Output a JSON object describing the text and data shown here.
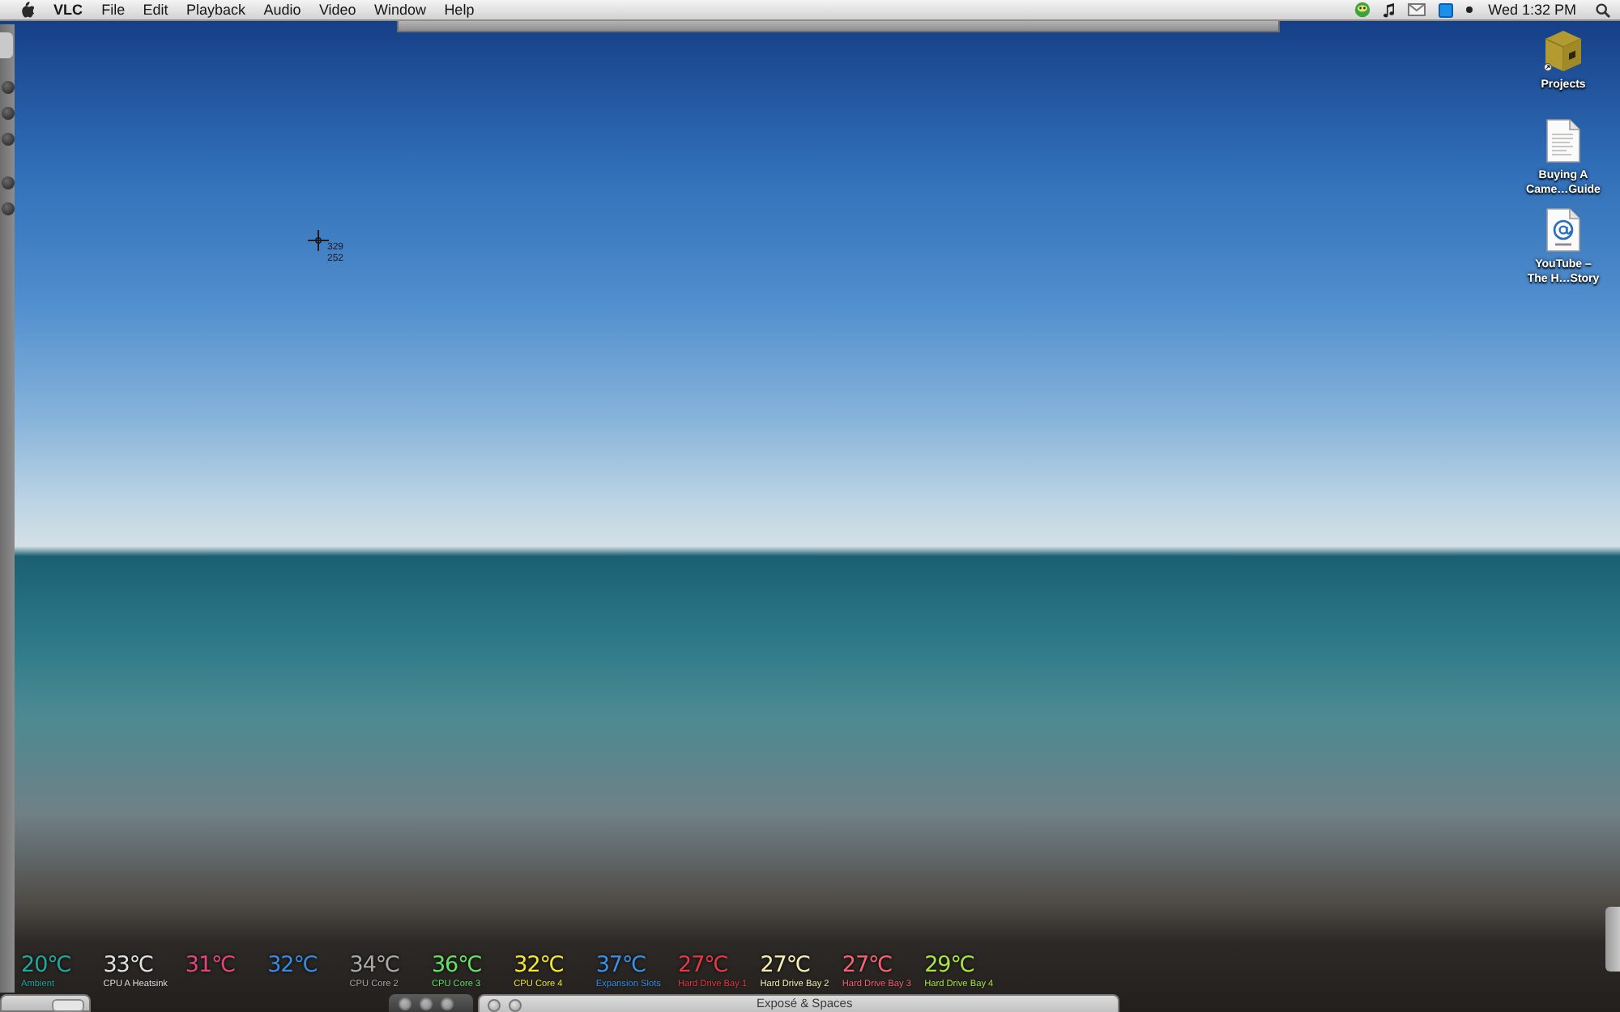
{
  "menu_bar": {
    "app_name": "VLC",
    "menus": [
      "File",
      "Edit",
      "Playback",
      "Audio",
      "Video",
      "Window",
      "Help"
    ],
    "clock": "Wed 1:32 PM"
  },
  "desktop_icons": [
    {
      "kind": "box",
      "label": "Projects"
    },
    {
      "kind": "document",
      "label": "Buying A Came…Guide"
    },
    {
      "kind": "weblink",
      "label": "YouTube – The H…Story"
    }
  ],
  "crosshair": {
    "readings": [
      "329",
      "252"
    ]
  },
  "sensors": [
    {
      "value": "20℃",
      "label": "Ambient",
      "color": "#22a89a"
    },
    {
      "value": "33℃",
      "label": "CPU A Heatsink",
      "color": "#e0e0e0"
    },
    {
      "value": "31℃",
      "color": "#e0467e"
    },
    {
      "value": "32℃",
      "color": "#3a8ae0"
    },
    {
      "value": "34℃",
      "label": "CPU Core 2",
      "color": "#a9a9a9"
    },
    {
      "value": "36℃",
      "label": "CPU Core 3",
      "color": "#66e066"
    },
    {
      "value": "32℃",
      "label": "CPU Core 4",
      "color": "#f2e634"
    },
    {
      "value": "37℃",
      "label": "Expansion Slots",
      "color": "#3b90e6"
    },
    {
      "value": "27℃",
      "label": "Hard Drive Bay 1",
      "color": "#e23a44"
    },
    {
      "value": "27℃",
      "label": "Hard Drive Bay 2",
      "color": "#f4eeb6"
    },
    {
      "value": "27℃",
      "label": "Hard Drive Bay 3",
      "color": "#f26474"
    },
    {
      "value": "29℃",
      "label": "Hard Drive Bay 4",
      "color": "#a9e244"
    }
  ],
  "bottom_window": {
    "title": "Exposé & Spaces"
  }
}
